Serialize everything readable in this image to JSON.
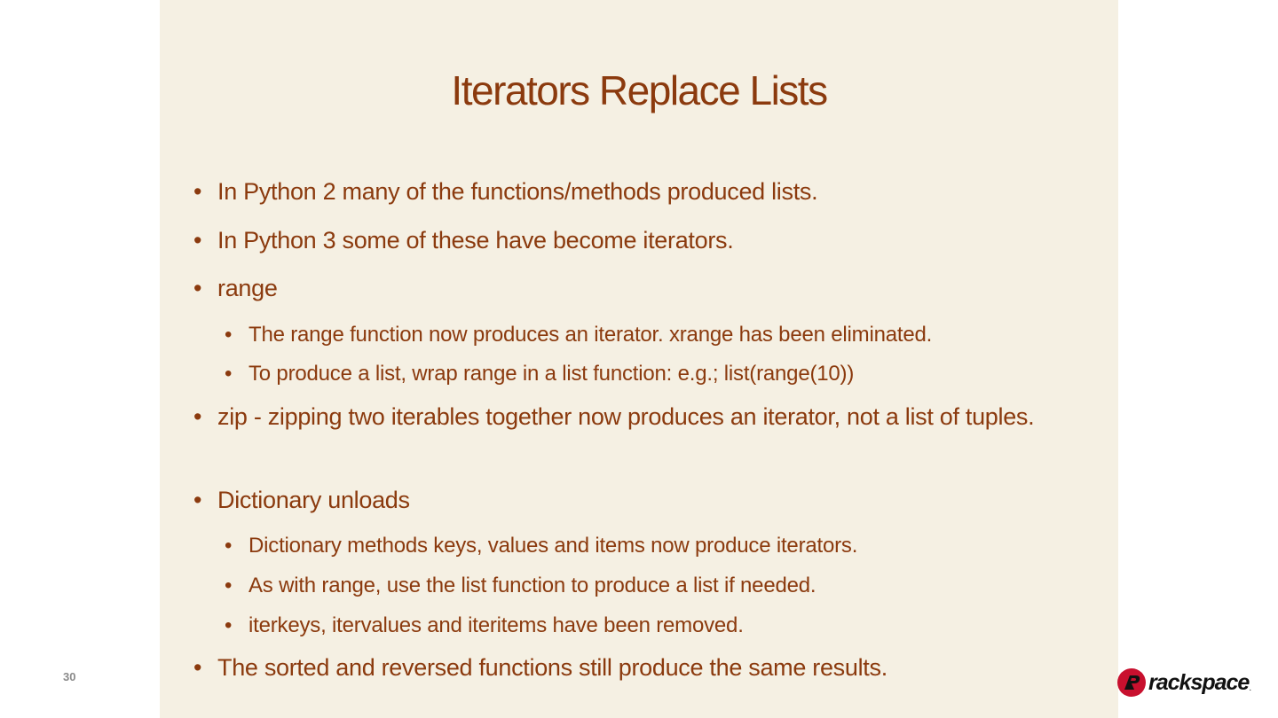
{
  "slide": {
    "title": "Iterators Replace Lists",
    "page_number": "30",
    "logo_text": "rackspace",
    "logo_dot": "."
  },
  "bullets": [
    {
      "level": 1,
      "text": "In Python 2 many of the functions/methods produced lists."
    },
    {
      "level": 1,
      "text": "In Python 3 some of these have become iterators."
    },
    {
      "level": 1,
      "text": "range"
    },
    {
      "level": 2,
      "text": "The range function now produces an iterator.   xrange has been eliminated."
    },
    {
      "level": 2,
      "text": "To produce a list, wrap range in a list function: e.g.; list(range(10))"
    },
    {
      "level": 1,
      "text": "zip - zipping two iterables together now produces an iterator, not a list of tuples."
    },
    {
      "level": 1,
      "text": "Dictionary unloads"
    },
    {
      "level": 2,
      "text": "Dictionary methods keys, values and items now produce iterators."
    },
    {
      "level": 2,
      "text": "As with range, use the list function to produce a list if needed."
    },
    {
      "level": 2,
      "text": "iterkeys, itervalues and iteritems have been removed."
    },
    {
      "level": 1,
      "text": "The sorted and reversed functions still produce the same results."
    }
  ],
  "colors": {
    "panel_background": "#f5f0e3",
    "text": "#8b3a0e",
    "logo_red": "#c8102e",
    "page_number": "#8a8a8a"
  }
}
